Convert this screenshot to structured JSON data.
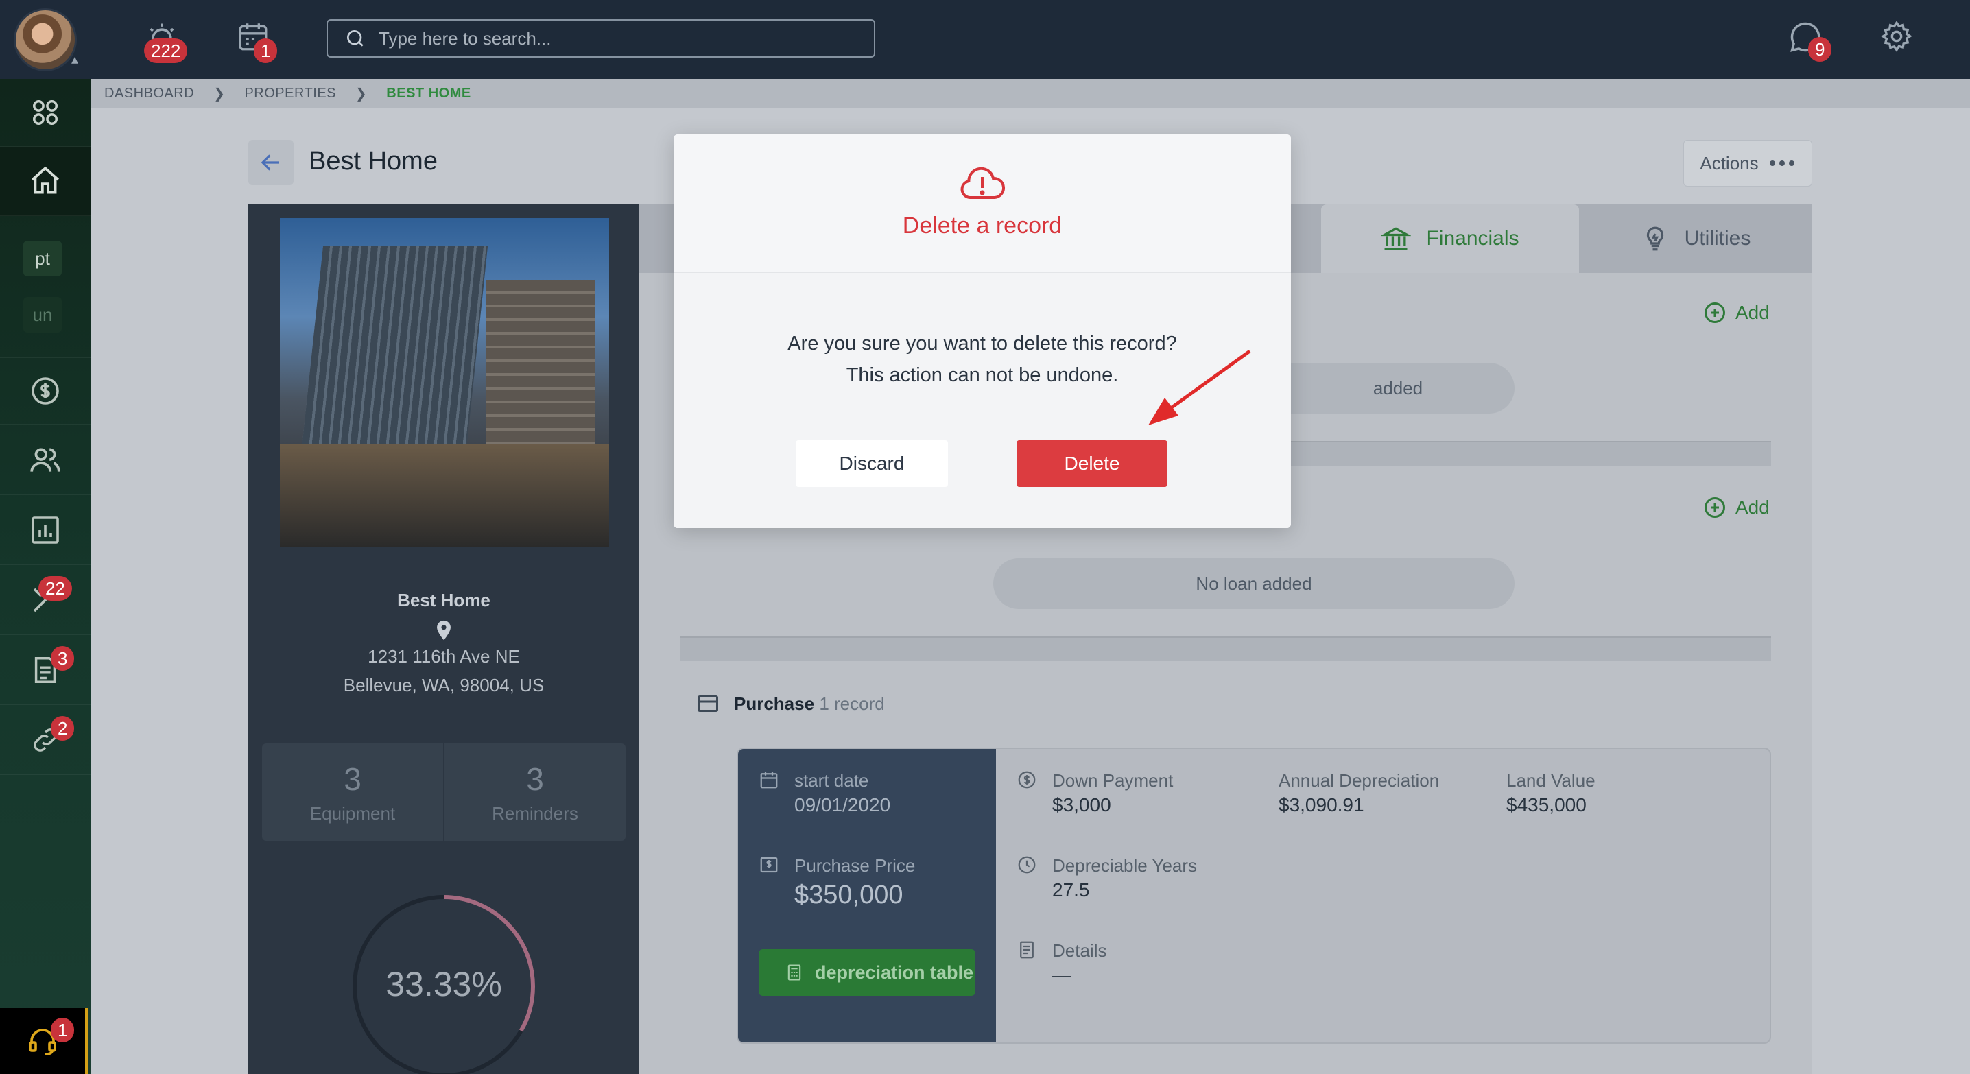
{
  "topbar": {
    "alerts_count": "222",
    "calendar_count": "1",
    "search_placeholder": "Type here to search...",
    "messages_count": "9"
  },
  "sidebar": {
    "chips": [
      "pt",
      "un"
    ],
    "badges": {
      "tools": "22",
      "documents": "3",
      "links": "2",
      "support": "1"
    }
  },
  "breadcrumb": {
    "items": [
      "DASHBOARD",
      "PROPERTIES",
      "BEST HOME"
    ]
  },
  "page": {
    "title": "Best Home",
    "actions_label": "Actions"
  },
  "property": {
    "name": "Best Home",
    "address_line1": "1231 116th Ave NE",
    "address_line2": "Bellevue, WA, 98004, US",
    "equipment_count": "3",
    "equipment_label": "Equipment",
    "reminders_count": "3",
    "reminders_label": "Reminders",
    "completion_percent": "33.33%",
    "completion_value": 0.3333
  },
  "tabs": {
    "financials": "Financials",
    "utilities": "Utilities"
  },
  "main": {
    "add_label": "Add",
    "first_empty_text": "added",
    "loan_empty_text": "No loan added",
    "purchase_title": "Purchase",
    "purchase_count": "1 record"
  },
  "purchase": {
    "start_date_label": "start date",
    "start_date_value": "09/01/2020",
    "price_label": "Purchase Price",
    "price_value": "$350,000",
    "depreciation_button": "depreciation table",
    "down_payment_label": "Down Payment",
    "down_payment_value": "$3,000",
    "annual_dep_label": "Annual Depreciation",
    "annual_dep_value": "$3,090.91",
    "land_value_label": "Land Value",
    "land_value_value": "$435,000",
    "dep_years_label": "Depreciable Years",
    "dep_years_value": "27.5",
    "details_label": "Details",
    "details_value": "—"
  },
  "modal": {
    "title": "Delete a record",
    "message": "Are you sure you want to delete this record? This action can not be undone.",
    "discard_label": "Discard",
    "delete_label": "Delete"
  },
  "colors": {
    "accent_green": "#2f7a3a",
    "danger_red": "#dc3c40",
    "topbar_bg": "#1e2a39"
  }
}
